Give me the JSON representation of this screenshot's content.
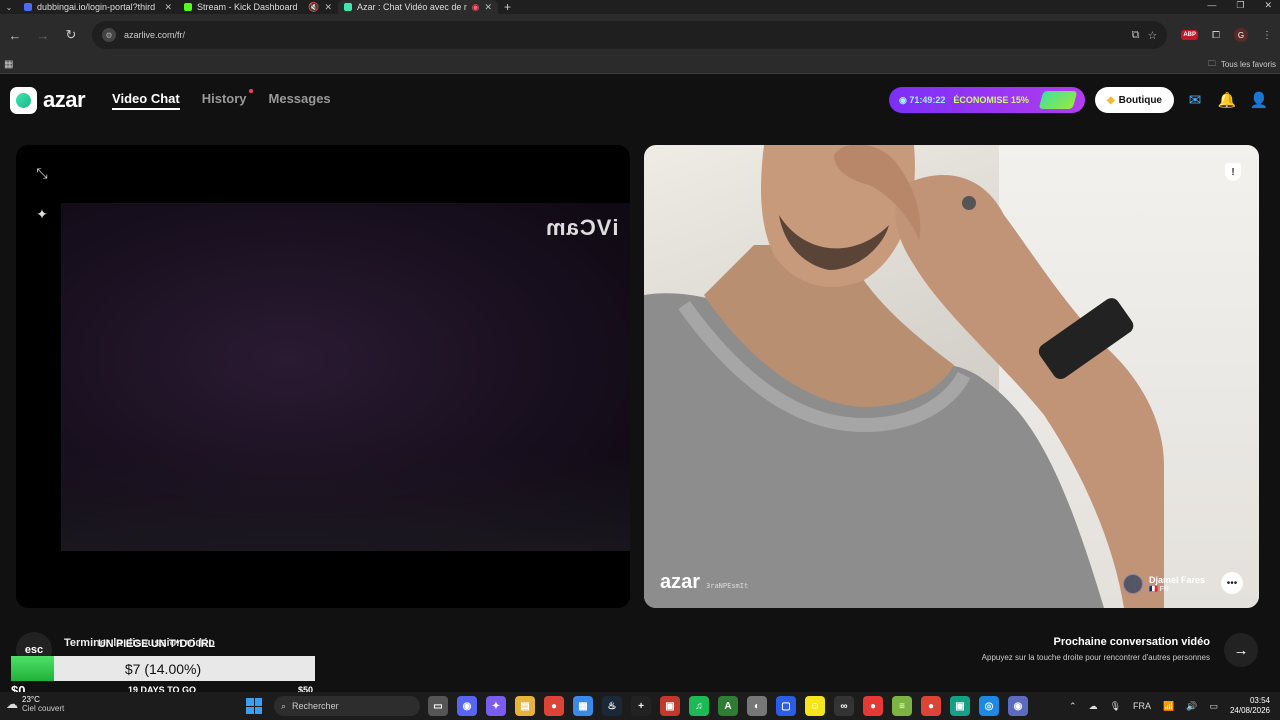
{
  "browser": {
    "tabs": [
      {
        "title": "dubbingai.io/login-portal?third",
        "color": "#4a6cf7"
      },
      {
        "title": "Stream - Kick Dashboard",
        "color": "#53fc18"
      },
      {
        "title": "Azar : Chat Vidéo avec de n",
        "color": "#3ee6b0"
      }
    ],
    "url": "azarlive.com/fr/",
    "abp_label": "ABP",
    "profile_initial": "G",
    "bookmarks_all": "Tous les favoris"
  },
  "header": {
    "logo_text": "azar",
    "nav": {
      "video_chat": "Video Chat",
      "history": "History",
      "messages": "Messages"
    },
    "promo": {
      "timer": "71:49:22",
      "text": "ÉCONOMISE 15%"
    },
    "boutique": "Boutique"
  },
  "left_panel": {
    "cam_watermark": "iVCam"
  },
  "right_panel": {
    "watermark_logo": "azar",
    "watermark_id": "3raNPEsmIt",
    "peer_name": "Djamel Fares",
    "peer_country": "FR"
  },
  "bottom": {
    "esc_label": "esc",
    "end_text": "Terminer la discussion vidéo",
    "next_title": "Prochaine conversation vidéo",
    "next_sub": "Appuyez sur la touche droite pour rencontrer d'autres personnes"
  },
  "donation_goal": {
    "title": "UN PIEGE UN T*DO IRL",
    "current": "$7 (14.00%)",
    "progress_percent": 14,
    "min": "$0",
    "days_left": "19 DAYS TO GO",
    "max": "$50"
  },
  "taskbar": {
    "temperature": "23°C",
    "weather_desc": "Ciel couvert",
    "search_placeholder": "Rechercher",
    "lang": "FRA",
    "time": "03:54",
    "date": "24/08/2026",
    "apps": [
      {
        "name": "task-view",
        "color": "#555",
        "glyph": "▭"
      },
      {
        "name": "discord",
        "color": "#5865f2",
        "glyph": "◉"
      },
      {
        "name": "copilot",
        "color": "#7a5cf0",
        "glyph": "✦"
      },
      {
        "name": "file-explorer",
        "color": "#e8b33a",
        "glyph": "▤"
      },
      {
        "name": "chrome",
        "color": "#db4437",
        "glyph": "●"
      },
      {
        "name": "store",
        "color": "#3a8be8",
        "glyph": "▦"
      },
      {
        "name": "steam",
        "color": "#1b2838",
        "glyph": "♨"
      },
      {
        "name": "add-app",
        "color": "#222",
        "glyph": "+"
      },
      {
        "name": "app-red",
        "color": "#c0392b",
        "glyph": "▣"
      },
      {
        "name": "spotify",
        "color": "#1db954",
        "glyph": "♫"
      },
      {
        "name": "app-green",
        "color": "#2e7d32",
        "glyph": "A"
      },
      {
        "name": "app-grey",
        "color": "#777",
        "glyph": "◐"
      },
      {
        "name": "app-blue",
        "color": "#2c5de5",
        "glyph": "▢"
      },
      {
        "name": "snapchat",
        "color": "#f7e51b",
        "glyph": "☺"
      },
      {
        "name": "app-dark",
        "color": "#333",
        "glyph": "∞"
      },
      {
        "name": "app-record",
        "color": "#e53935",
        "glyph": "●"
      },
      {
        "name": "app-layers",
        "color": "#7cb342",
        "glyph": "≡"
      },
      {
        "name": "chrome-2",
        "color": "#db4437",
        "glyph": "●"
      },
      {
        "name": "app-teal",
        "color": "#16a085",
        "glyph": "▣"
      },
      {
        "name": "app-blue-2",
        "color": "#1e88e5",
        "glyph": "◎"
      },
      {
        "name": "app-blue-3",
        "color": "#5c6bc0",
        "glyph": "◉"
      }
    ]
  }
}
